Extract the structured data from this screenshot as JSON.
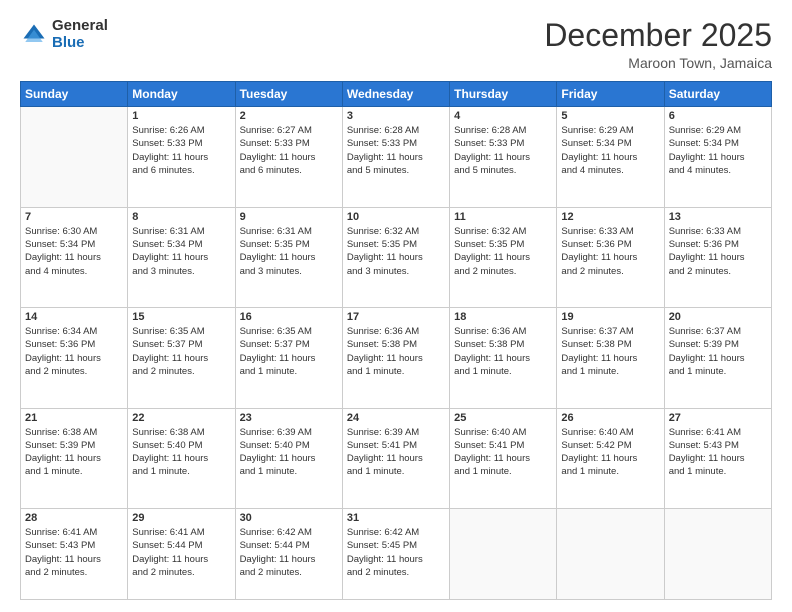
{
  "logo": {
    "general": "General",
    "blue": "Blue"
  },
  "header": {
    "month": "December 2025",
    "location": "Maroon Town, Jamaica"
  },
  "weekdays": [
    "Sunday",
    "Monday",
    "Tuesday",
    "Wednesday",
    "Thursday",
    "Friday",
    "Saturday"
  ],
  "weeks": [
    [
      {
        "day": "",
        "info": ""
      },
      {
        "day": "1",
        "info": "Sunrise: 6:26 AM\nSunset: 5:33 PM\nDaylight: 11 hours\nand 6 minutes."
      },
      {
        "day": "2",
        "info": "Sunrise: 6:27 AM\nSunset: 5:33 PM\nDaylight: 11 hours\nand 6 minutes."
      },
      {
        "day": "3",
        "info": "Sunrise: 6:28 AM\nSunset: 5:33 PM\nDaylight: 11 hours\nand 5 minutes."
      },
      {
        "day": "4",
        "info": "Sunrise: 6:28 AM\nSunset: 5:33 PM\nDaylight: 11 hours\nand 5 minutes."
      },
      {
        "day": "5",
        "info": "Sunrise: 6:29 AM\nSunset: 5:34 PM\nDaylight: 11 hours\nand 4 minutes."
      },
      {
        "day": "6",
        "info": "Sunrise: 6:29 AM\nSunset: 5:34 PM\nDaylight: 11 hours\nand 4 minutes."
      }
    ],
    [
      {
        "day": "7",
        "info": "Sunrise: 6:30 AM\nSunset: 5:34 PM\nDaylight: 11 hours\nand 4 minutes."
      },
      {
        "day": "8",
        "info": "Sunrise: 6:31 AM\nSunset: 5:34 PM\nDaylight: 11 hours\nand 3 minutes."
      },
      {
        "day": "9",
        "info": "Sunrise: 6:31 AM\nSunset: 5:35 PM\nDaylight: 11 hours\nand 3 minutes."
      },
      {
        "day": "10",
        "info": "Sunrise: 6:32 AM\nSunset: 5:35 PM\nDaylight: 11 hours\nand 3 minutes."
      },
      {
        "day": "11",
        "info": "Sunrise: 6:32 AM\nSunset: 5:35 PM\nDaylight: 11 hours\nand 2 minutes."
      },
      {
        "day": "12",
        "info": "Sunrise: 6:33 AM\nSunset: 5:36 PM\nDaylight: 11 hours\nand 2 minutes."
      },
      {
        "day": "13",
        "info": "Sunrise: 6:33 AM\nSunset: 5:36 PM\nDaylight: 11 hours\nand 2 minutes."
      }
    ],
    [
      {
        "day": "14",
        "info": "Sunrise: 6:34 AM\nSunset: 5:36 PM\nDaylight: 11 hours\nand 2 minutes."
      },
      {
        "day": "15",
        "info": "Sunrise: 6:35 AM\nSunset: 5:37 PM\nDaylight: 11 hours\nand 2 minutes."
      },
      {
        "day": "16",
        "info": "Sunrise: 6:35 AM\nSunset: 5:37 PM\nDaylight: 11 hours\nand 1 minute."
      },
      {
        "day": "17",
        "info": "Sunrise: 6:36 AM\nSunset: 5:38 PM\nDaylight: 11 hours\nand 1 minute."
      },
      {
        "day": "18",
        "info": "Sunrise: 6:36 AM\nSunset: 5:38 PM\nDaylight: 11 hours\nand 1 minute."
      },
      {
        "day": "19",
        "info": "Sunrise: 6:37 AM\nSunset: 5:38 PM\nDaylight: 11 hours\nand 1 minute."
      },
      {
        "day": "20",
        "info": "Sunrise: 6:37 AM\nSunset: 5:39 PM\nDaylight: 11 hours\nand 1 minute."
      }
    ],
    [
      {
        "day": "21",
        "info": "Sunrise: 6:38 AM\nSunset: 5:39 PM\nDaylight: 11 hours\nand 1 minute."
      },
      {
        "day": "22",
        "info": "Sunrise: 6:38 AM\nSunset: 5:40 PM\nDaylight: 11 hours\nand 1 minute."
      },
      {
        "day": "23",
        "info": "Sunrise: 6:39 AM\nSunset: 5:40 PM\nDaylight: 11 hours\nand 1 minute."
      },
      {
        "day": "24",
        "info": "Sunrise: 6:39 AM\nSunset: 5:41 PM\nDaylight: 11 hours\nand 1 minute."
      },
      {
        "day": "25",
        "info": "Sunrise: 6:40 AM\nSunset: 5:41 PM\nDaylight: 11 hours\nand 1 minute."
      },
      {
        "day": "26",
        "info": "Sunrise: 6:40 AM\nSunset: 5:42 PM\nDaylight: 11 hours\nand 1 minute."
      },
      {
        "day": "27",
        "info": "Sunrise: 6:41 AM\nSunset: 5:43 PM\nDaylight: 11 hours\nand 1 minute."
      }
    ],
    [
      {
        "day": "28",
        "info": "Sunrise: 6:41 AM\nSunset: 5:43 PM\nDaylight: 11 hours\nand 2 minutes."
      },
      {
        "day": "29",
        "info": "Sunrise: 6:41 AM\nSunset: 5:44 PM\nDaylight: 11 hours\nand 2 minutes."
      },
      {
        "day": "30",
        "info": "Sunrise: 6:42 AM\nSunset: 5:44 PM\nDaylight: 11 hours\nand 2 minutes."
      },
      {
        "day": "31",
        "info": "Sunrise: 6:42 AM\nSunset: 5:45 PM\nDaylight: 11 hours\nand 2 minutes."
      },
      {
        "day": "",
        "info": ""
      },
      {
        "day": "",
        "info": ""
      },
      {
        "day": "",
        "info": ""
      }
    ]
  ]
}
